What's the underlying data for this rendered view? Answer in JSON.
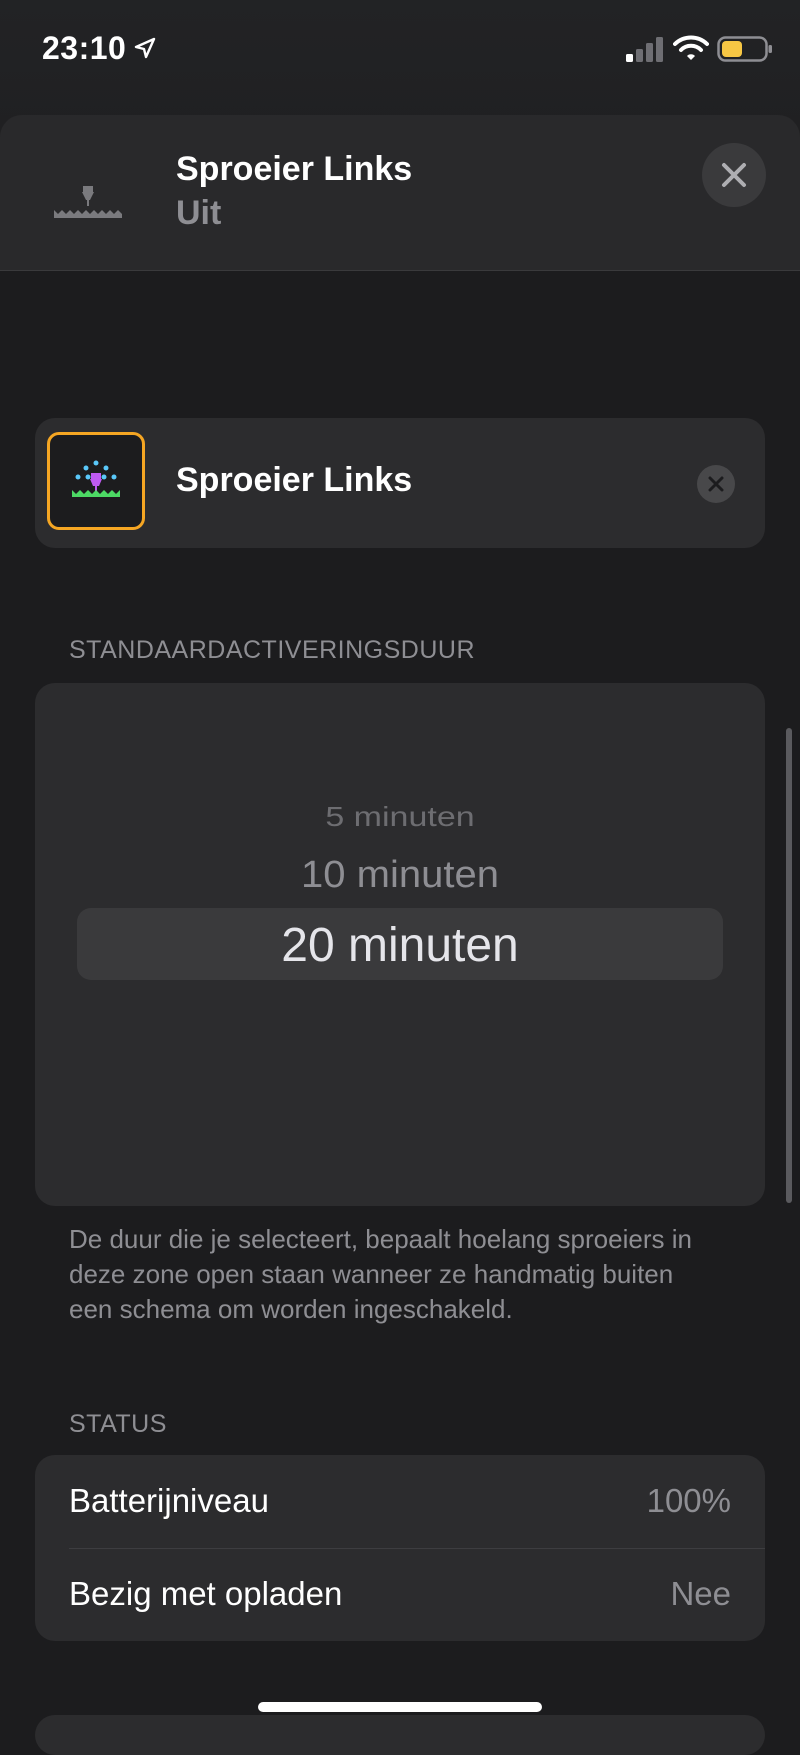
{
  "status_bar": {
    "time": "23:10",
    "icons": [
      "location-arrow-icon",
      "cellular-signal-icon",
      "wifi-icon",
      "battery-icon"
    ],
    "battery_color": "#f7c744"
  },
  "header": {
    "title": "Sproeier Links",
    "subtitle": "Uit",
    "icon": "sprinkler-icon",
    "close_icon": "close-icon"
  },
  "accessory": {
    "name": "Sproeier Links",
    "icon": "sprinkler-icon",
    "accent_color": "#f5a623",
    "clear_icon": "clear-icon"
  },
  "duration_section": {
    "label": "STANDAARDACTIVERINGSDUUR",
    "options": [
      "5 minuten",
      "10 minuten",
      "20 minuten"
    ],
    "selected": "20 minuten",
    "footnote": "De duur die je selecteert, bepaalt hoelang sproeiers in deze zone open staan wanneer ze handmatig buiten een schema om worden ingeschakeld."
  },
  "status_section": {
    "label": "STATUS",
    "rows": [
      {
        "label": "Batterijniveau",
        "value": "100%"
      },
      {
        "label": "Bezig met opladen",
        "value": "Nee"
      }
    ]
  },
  "colors": {
    "background": "#1c1c1e",
    "card": "#2c2c2e",
    "secondary_text": "#8e8e93"
  }
}
